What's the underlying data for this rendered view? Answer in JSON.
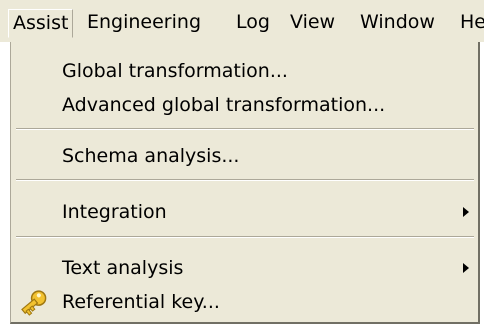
{
  "menubar": {
    "items": [
      {
        "label": "Assist"
      },
      {
        "label": "Engineering"
      },
      {
        "label": "Log"
      },
      {
        "label": "View"
      },
      {
        "label": "Window"
      },
      {
        "label": "He"
      }
    ]
  },
  "dropdown": {
    "items": [
      {
        "label": "Global transformation..."
      },
      {
        "label": "Advanced global transformation..."
      },
      {
        "label": "Schema analysis..."
      },
      {
        "label": "Integration"
      },
      {
        "label": "Text analysis"
      },
      {
        "label": "Referential key..."
      }
    ],
    "icons": {
      "referential_key": "key-icon"
    }
  }
}
